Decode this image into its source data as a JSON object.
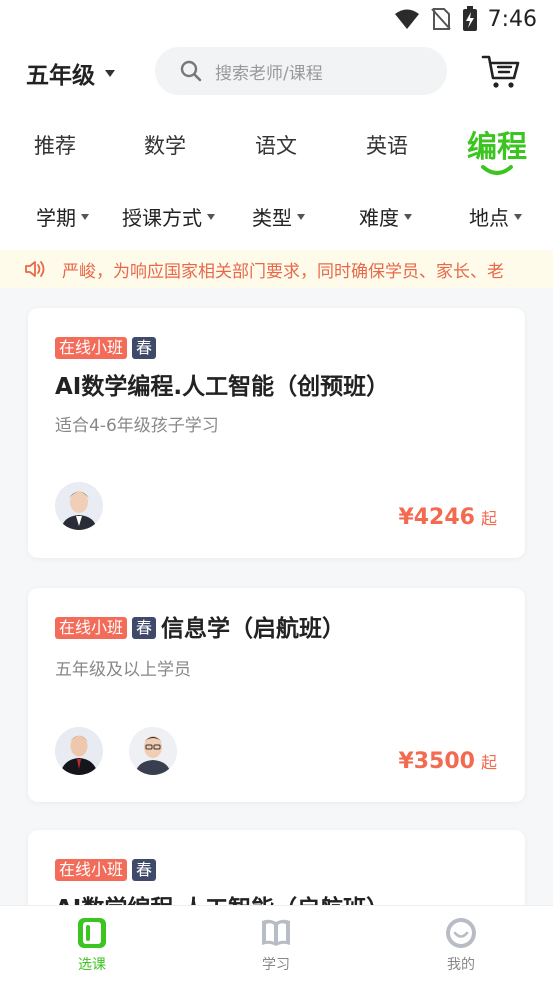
{
  "status_bar": {
    "time": "7:46"
  },
  "header": {
    "grade_label": "五年级",
    "search_placeholder": "搜索老师/课程"
  },
  "subject_tabs": [
    {
      "label": "推荐",
      "active": false
    },
    {
      "label": "数学",
      "active": false
    },
    {
      "label": "语文",
      "active": false
    },
    {
      "label": "英语",
      "active": false
    },
    {
      "label": "编程",
      "active": true
    }
  ],
  "filters": [
    {
      "label": "学期"
    },
    {
      "label": "授课方式"
    },
    {
      "label": "类型"
    },
    {
      "label": "难度"
    },
    {
      "label": "地点"
    }
  ],
  "notice": {
    "text": "严峻，为响应国家相关部门要求，同时确保学员、家长、老"
  },
  "courses": [
    {
      "tag_mode": "在线小班",
      "tag_season": "春",
      "title": "AI数学编程.人工智能（创预班）",
      "subtitle": "适合4-6年级孩子学习",
      "price": "¥4246",
      "price_suffix": "起"
    },
    {
      "tag_mode": "在线小班",
      "tag_season": "春",
      "title": "信息学（启航班）",
      "subtitle": "五年级及以上学员",
      "price": "¥3500",
      "price_suffix": "起"
    },
    {
      "tag_mode": "在线小班",
      "tag_season": "春",
      "title": "AI数学编程.人工智能（启航班）"
    }
  ],
  "bottom_nav": [
    {
      "label": "选课",
      "active": true
    },
    {
      "label": "学习",
      "active": false
    },
    {
      "label": "我的",
      "active": false
    }
  ],
  "colors": {
    "accent_green": "#3cc421",
    "price_red": "#f26a4f",
    "tag_online": "#f36c5a",
    "tag_season": "#3f4a6a",
    "notice_text": "#e8694a"
  }
}
